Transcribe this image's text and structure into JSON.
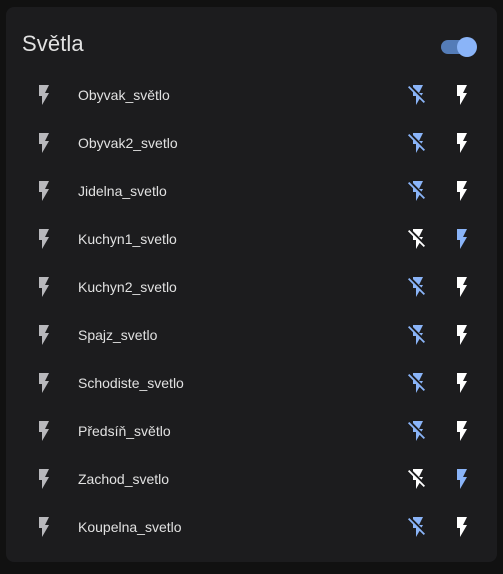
{
  "card": {
    "title": "Světla",
    "toggle_state": "on"
  },
  "colors": {
    "active": "#8ab4f8",
    "inactive": "#ffffff",
    "state_icon": "#b8b8bc",
    "text": "#e1e1e1"
  },
  "icons": {
    "state": "flash-icon",
    "off_action": "flash-off-icon",
    "on_action": "flash-icon"
  },
  "entities": [
    {
      "name": "Obyvak_světlo",
      "state": "off"
    },
    {
      "name": "Obyvak2_svetlo",
      "state": "off"
    },
    {
      "name": "Jidelna_svetlo",
      "state": "off"
    },
    {
      "name": "Kuchyn1_svetlo",
      "state": "on"
    },
    {
      "name": "Kuchyn2_svetlo",
      "state": "off"
    },
    {
      "name": "Spajz_svetlo",
      "state": "off"
    },
    {
      "name": "Schodiste_svetlo",
      "state": "off"
    },
    {
      "name": "Předsíň_světlo",
      "state": "off"
    },
    {
      "name": "Zachod_svetlo",
      "state": "on"
    },
    {
      "name": "Koupelna_svetlo",
      "state": "off"
    }
  ]
}
